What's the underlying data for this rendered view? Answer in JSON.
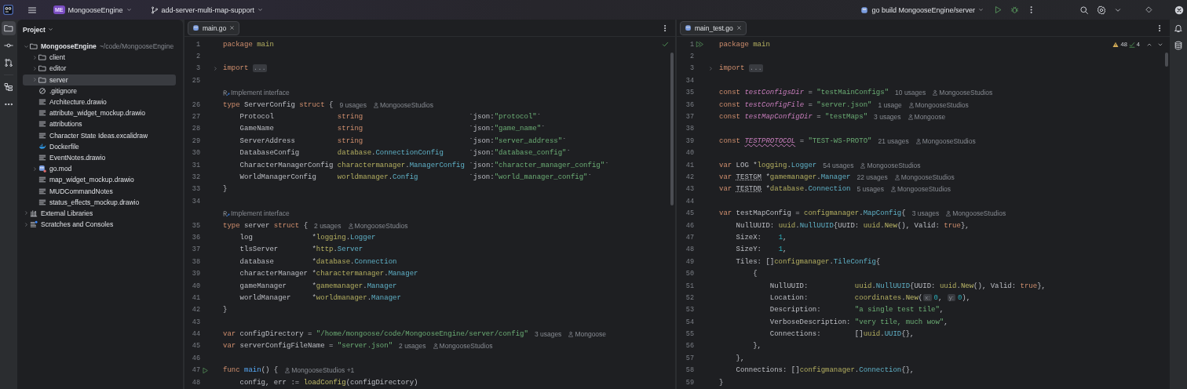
{
  "title_bar": {
    "project_badge": "ME",
    "project": "MongooseEngine",
    "branch": "add-server-multi-map-support",
    "run_configuration": "go build MongooseEngine/server"
  },
  "left_toolbar": [
    {
      "kind": "project",
      "selected": true
    },
    {
      "kind": "commit",
      "selected": false
    },
    {
      "kind": "pull-requests",
      "selected": false
    },
    {
      "kind": "structure",
      "selected": false
    },
    {
      "kind": "more",
      "selected": false
    }
  ],
  "right_toolbar": [
    {
      "kind": "notifications",
      "selected": false
    },
    {
      "kind": "database",
      "selected": false
    }
  ],
  "project": {
    "title": "Project",
    "tree": [
      {
        "label": "MongooseEngine",
        "hint": "~/code/MongooseEngine",
        "kind": "folder",
        "expanded": true,
        "selected": false,
        "children": [
          {
            "label": "client",
            "kind": "folder",
            "expanded": false,
            "selected": false
          },
          {
            "label": "editor",
            "kind": "folder",
            "expanded": false,
            "selected": false
          },
          {
            "label": "server",
            "kind": "folder",
            "expanded": false,
            "selected": true
          },
          {
            "label": ".gitignore",
            "kind": "ignore",
            "selected": false
          },
          {
            "label": "Architecture.drawio",
            "kind": "text",
            "selected": false
          },
          {
            "label": "attribute_widget_mockup.drawio",
            "kind": "text",
            "selected": false
          },
          {
            "label": "attributions",
            "kind": "text",
            "selected": false
          },
          {
            "label": "Character State Ideas.excalidraw",
            "kind": "text",
            "selected": false
          },
          {
            "label": "Dockerfile",
            "kind": "docker",
            "selected": false
          },
          {
            "label": "EventNotes.drawio",
            "kind": "text",
            "selected": false
          },
          {
            "label": "go.mod",
            "kind": "gomod",
            "expanded": false,
            "selected": false
          },
          {
            "label": "map_widget_mockup.drawio",
            "kind": "text",
            "selected": false
          },
          {
            "label": "MUDCommandNotes",
            "kind": "text",
            "selected": false
          },
          {
            "label": "status_effects_mockup.drawio",
            "kind": "text",
            "selected": false
          }
        ]
      },
      {
        "label": "External Libraries",
        "kind": "library",
        "expanded": false,
        "selected": false
      },
      {
        "label": "Scratches and Consoles",
        "kind": "scratches",
        "expanded": false,
        "selected": false
      }
    ]
  },
  "editors": [
    {
      "tabs": [
        {
          "label": "main.go",
          "selected": true
        }
      ],
      "inspection": {
        "kind": "clean"
      },
      "lines": [
        {
          "number": "1",
          "code": [
            {
              "kind": "kw",
              "text": "package"
            },
            {
              "kind": "pkg",
              "text": " main"
            }
          ]
        },
        {
          "number": "2"
        },
        {
          "number": "3",
          "kind": "fold",
          "code": [
            {
              "kind": "kw",
              "text": "import"
            },
            {
              "kind": "fold",
              "text": "..."
            }
          ]
        },
        {
          "number": "25"
        },
        {
          "kind": "lens",
          "text": "Implement interface"
        },
        {
          "number": "26",
          "code": [
            {
              "kind": "kw",
              "text": "type"
            },
            {
              "kind": "plain",
              "text": " ServerConfig "
            },
            {
              "kind": "kw",
              "text": "struct"
            },
            {
              "kind": "plain",
              "text": " {"
            }
          ],
          "hints": [
            {
              "kind": "usages",
              "text": "9 usages"
            },
            {
              "kind": "author",
              "text": "MongooseStudios"
            }
          ]
        },
        {
          "number": "27",
          "code": [
            {
              "kind": "plain",
              "text": "    Protocol               "
            },
            {
              "kind": "kw",
              "text": "string"
            },
            {
              "kind": "plain",
              "text": "                         `json:"
            },
            {
              "kind": "str",
              "text": "\"protocol\""
            },
            {
              "kind": "plain",
              "text": "`"
            }
          ]
        },
        {
          "number": "28",
          "code": [
            {
              "kind": "plain",
              "text": "    GameName               "
            },
            {
              "kind": "kw",
              "text": "string"
            },
            {
              "kind": "plain",
              "text": "                         `json:"
            },
            {
              "kind": "str",
              "text": "\"game_name\""
            },
            {
              "kind": "plain",
              "text": "`"
            }
          ]
        },
        {
          "number": "29",
          "code": [
            {
              "kind": "plain",
              "text": "    ServerAddress          "
            },
            {
              "kind": "kw",
              "text": "string"
            },
            {
              "kind": "plain",
              "text": "                         `json:"
            },
            {
              "kind": "str",
              "text": "\"server_address\""
            },
            {
              "kind": "plain",
              "text": "`"
            }
          ]
        },
        {
          "number": "30",
          "code": [
            {
              "kind": "plain",
              "text": "    DatabaseConfig         "
            },
            {
              "kind": "pkg",
              "text": "database"
            },
            {
              "kind": "plain",
              "text": "."
            },
            {
              "kind": "type",
              "text": "ConnectionConfig"
            },
            {
              "kind": "plain",
              "text": "      `json:"
            },
            {
              "kind": "str",
              "text": "\"database_config\""
            },
            {
              "kind": "plain",
              "text": "`"
            }
          ]
        },
        {
          "number": "31",
          "code": [
            {
              "kind": "plain",
              "text": "    CharacterManagerConfig "
            },
            {
              "kind": "pkg",
              "text": "charactermanager"
            },
            {
              "kind": "plain",
              "text": "."
            },
            {
              "kind": "type",
              "text": "ManagerConfig"
            },
            {
              "kind": "plain",
              "text": " `json:"
            },
            {
              "kind": "str",
              "text": "\"character_manager_config\""
            },
            {
              "kind": "plain",
              "text": "`"
            }
          ]
        },
        {
          "number": "32",
          "code": [
            {
              "kind": "plain",
              "text": "    WorldManagerConfig     "
            },
            {
              "kind": "pkg",
              "text": "worldmanager"
            },
            {
              "kind": "plain",
              "text": "."
            },
            {
              "kind": "type",
              "text": "Config"
            },
            {
              "kind": "plain",
              "text": "            `json:"
            },
            {
              "kind": "str",
              "text": "\"world_manager_config\""
            },
            {
              "kind": "plain",
              "text": "`"
            }
          ]
        },
        {
          "number": "33",
          "code": [
            {
              "kind": "plain",
              "text": "}"
            }
          ]
        },
        {
          "number": "34"
        },
        {
          "kind": "lens",
          "text": "Implement interface"
        },
        {
          "number": "35",
          "code": [
            {
              "kind": "kw",
              "text": "type"
            },
            {
              "kind": "plain",
              "text": " server "
            },
            {
              "kind": "kw",
              "text": "struct"
            },
            {
              "kind": "plain",
              "text": " {"
            }
          ],
          "hints": [
            {
              "kind": "usages",
              "text": "2 usages"
            },
            {
              "kind": "author",
              "text": "MongooseStudios"
            }
          ]
        },
        {
          "number": "36",
          "code": [
            {
              "kind": "plain",
              "text": "    log              *"
            },
            {
              "kind": "pkg",
              "text": "logging"
            },
            {
              "kind": "plain",
              "text": "."
            },
            {
              "kind": "type",
              "text": "Logger"
            }
          ]
        },
        {
          "number": "37",
          "code": [
            {
              "kind": "plain",
              "text": "    tlsServer        *"
            },
            {
              "kind": "pkg",
              "text": "http"
            },
            {
              "kind": "plain",
              "text": "."
            },
            {
              "kind": "type",
              "text": "Server"
            }
          ]
        },
        {
          "number": "38",
          "code": [
            {
              "kind": "plain",
              "text": "    database         *"
            },
            {
              "kind": "pkg",
              "text": "database"
            },
            {
              "kind": "plain",
              "text": "."
            },
            {
              "kind": "type",
              "text": "Connection"
            }
          ]
        },
        {
          "number": "39",
          "code": [
            {
              "kind": "plain",
              "text": "    characterManager *"
            },
            {
              "kind": "pkg",
              "text": "charactermanager"
            },
            {
              "kind": "plain",
              "text": "."
            },
            {
              "kind": "type",
              "text": "Manager"
            }
          ]
        },
        {
          "number": "40",
          "code": [
            {
              "kind": "plain",
              "text": "    gameManager      *"
            },
            {
              "kind": "pkg",
              "text": "gamemanager"
            },
            {
              "kind": "plain",
              "text": "."
            },
            {
              "kind": "type",
              "text": "Manager"
            }
          ]
        },
        {
          "number": "41",
          "code": [
            {
              "kind": "plain",
              "text": "    worldManager     *"
            },
            {
              "kind": "pkg",
              "text": "worldmanager"
            },
            {
              "kind": "plain",
              "text": "."
            },
            {
              "kind": "type",
              "text": "Manager"
            }
          ]
        },
        {
          "number": "42",
          "code": [
            {
              "kind": "plain",
              "text": "}"
            }
          ]
        },
        {
          "number": "43"
        },
        {
          "number": "44",
          "code": [
            {
              "kind": "kw",
              "text": "var"
            },
            {
              "kind": "plain",
              "text": " configDirectory = "
            },
            {
              "kind": "str",
              "text": "\"/home/mongoose/code/MongooseEngine/server/config\""
            }
          ],
          "hints": [
            {
              "kind": "usages",
              "text": "3 usages"
            },
            {
              "kind": "author",
              "text": "Mongoose"
            }
          ]
        },
        {
          "number": "45",
          "code": [
            {
              "kind": "kw",
              "text": "var"
            },
            {
              "kind": "plain",
              "text": " serverConfigFileName = "
            },
            {
              "kind": "str",
              "text": "\"server.json\""
            }
          ],
          "hints": [
            {
              "kind": "usages",
              "text": "2 usages"
            },
            {
              "kind": "author",
              "text": "MongooseStudios"
            }
          ]
        },
        {
          "number": "46"
        },
        {
          "number": "47",
          "kind": "run",
          "code": [
            {
              "kind": "kw",
              "text": "func"
            },
            {
              "kind": "decl",
              "text": " main"
            },
            {
              "kind": "plain",
              "text": "() {"
            }
          ],
          "hints": [
            {
              "kind": "author",
              "text": "MongooseStudios +1"
            }
          ]
        },
        {
          "number": "48",
          "code": [
            {
              "kind": "plain",
              "text": "    config, err := "
            },
            {
              "kind": "fn",
              "text": "loadConfig"
            },
            {
              "kind": "plain",
              "text": "(configDirectory)"
            }
          ]
        }
      ]
    },
    {
      "tabs": [
        {
          "label": "main_test.go",
          "selected": true
        }
      ],
      "inspection": {
        "kind": "counts",
        "warnings": "48",
        "weak_warnings": "4"
      },
      "lines": [
        {
          "number": "1",
          "kind": "run-all",
          "code": [
            {
              "kind": "kw",
              "text": "package"
            },
            {
              "kind": "pkg",
              "text": " main"
            }
          ]
        },
        {
          "number": "2"
        },
        {
          "number": "3",
          "kind": "fold",
          "code": [
            {
              "kind": "kw",
              "text": "import"
            },
            {
              "kind": "fold",
              "text": "..."
            }
          ]
        },
        {
          "number": "34"
        },
        {
          "number": "35",
          "code": [
            {
              "kind": "kw",
              "text": "const"
            },
            {
              "kind": "const",
              "text": " testConfigsDir"
            },
            {
              "kind": "plain",
              "text": " = "
            },
            {
              "kind": "str",
              "text": "\"testMainConfigs\""
            }
          ],
          "hints": [
            {
              "kind": "usages",
              "text": "10 usages"
            },
            {
              "kind": "author",
              "text": "MongooseStudios"
            }
          ]
        },
        {
          "number": "36",
          "code": [
            {
              "kind": "kw",
              "text": "const"
            },
            {
              "kind": "const",
              "text": " testConfigFile"
            },
            {
              "kind": "plain",
              "text": " = "
            },
            {
              "kind": "str",
              "text": "\"server.json\""
            }
          ],
          "hints": [
            {
              "kind": "usages",
              "text": "1 usage"
            },
            {
              "kind": "author",
              "text": "MongooseStudios"
            }
          ]
        },
        {
          "number": "37",
          "code": [
            {
              "kind": "kw",
              "text": "const"
            },
            {
              "kind": "const",
              "text": " testMapConfigDir"
            },
            {
              "kind": "plain",
              "text": " = "
            },
            {
              "kind": "str",
              "text": "\"testMaps\""
            }
          ],
          "hints": [
            {
              "kind": "usages",
              "text": "3 usages"
            },
            {
              "kind": "author",
              "text": "Mongoose"
            }
          ]
        },
        {
          "number": "38"
        },
        {
          "number": "39",
          "code": [
            {
              "kind": "kw",
              "text": "const"
            },
            {
              "kind": "const-warn",
              "text": "TESTPROTOCOL"
            },
            {
              "kind": "plain",
              "text": " = "
            },
            {
              "kind": "str",
              "text": "\"TEST-WS-PROTO\""
            }
          ],
          "hints": [
            {
              "kind": "usages",
              "text": "21 usages"
            },
            {
              "kind": "author",
              "text": "MongooseStudios"
            }
          ]
        },
        {
          "number": "40"
        },
        {
          "number": "41",
          "code": [
            {
              "kind": "kw",
              "text": "var"
            },
            {
              "kind": "plain",
              "text": " LOG *"
            },
            {
              "kind": "pkg",
              "text": "logging"
            },
            {
              "kind": "plain",
              "text": "."
            },
            {
              "kind": "type",
              "text": "Logger"
            }
          ],
          "hints": [
            {
              "kind": "usages",
              "text": "54 usages"
            },
            {
              "kind": "author",
              "text": "MongooseStudios"
            }
          ]
        },
        {
          "number": "42",
          "code": [
            {
              "kind": "kw",
              "text": "var"
            },
            {
              "kind": "plain-warn",
              "text": "TESTGM"
            },
            {
              "kind": "plain",
              "text": " *"
            },
            {
              "kind": "pkg",
              "text": "gamemanager"
            },
            {
              "kind": "plain",
              "text": "."
            },
            {
              "kind": "type",
              "text": "Manager"
            }
          ],
          "hints": [
            {
              "kind": "usages",
              "text": "22 usages"
            },
            {
              "kind": "author",
              "text": "MongooseStudios"
            }
          ]
        },
        {
          "number": "43",
          "code": [
            {
              "kind": "kw",
              "text": "var"
            },
            {
              "kind": "plain-warn",
              "text": "TESTDB"
            },
            {
              "kind": "plain",
              "text": " *"
            },
            {
              "kind": "pkg",
              "text": "database"
            },
            {
              "kind": "plain",
              "text": "."
            },
            {
              "kind": "type",
              "text": "Connection"
            }
          ],
          "hints": [
            {
              "kind": "usages",
              "text": "5 usages"
            },
            {
              "kind": "author",
              "text": "MongooseStudios"
            }
          ]
        },
        {
          "number": "44"
        },
        {
          "number": "45",
          "code": [
            {
              "kind": "kw",
              "text": "var"
            },
            {
              "kind": "plain",
              "text": " testMapConfig = "
            },
            {
              "kind": "pkg",
              "text": "configmanager"
            },
            {
              "kind": "plain",
              "text": "."
            },
            {
              "kind": "type",
              "text": "MapConfig"
            },
            {
              "kind": "plain",
              "text": "{"
            }
          ],
          "hints": [
            {
              "kind": "usages",
              "text": "3 usages"
            },
            {
              "kind": "author",
              "text": "MongooseStudios"
            }
          ]
        },
        {
          "number": "46",
          "code": [
            {
              "kind": "plain",
              "text": "    NullUUID: "
            },
            {
              "kind": "pkg",
              "text": "uuid"
            },
            {
              "kind": "plain",
              "text": "."
            },
            {
              "kind": "type",
              "text": "NullUUID"
            },
            {
              "kind": "plain",
              "text": "{UUID: "
            },
            {
              "kind": "pkg",
              "text": "uuid"
            },
            {
              "kind": "plain",
              "text": "."
            },
            {
              "kind": "fn",
              "text": "New"
            },
            {
              "kind": "plain",
              "text": "(), Valid: "
            },
            {
              "kind": "kw",
              "text": "true"
            },
            {
              "kind": "plain",
              "text": "},"
            }
          ]
        },
        {
          "number": "47",
          "code": [
            {
              "kind": "plain",
              "text": "    SizeX:    "
            },
            {
              "kind": "num",
              "text": "1"
            },
            {
              "kind": "plain",
              "text": ","
            }
          ]
        },
        {
          "number": "48",
          "code": [
            {
              "kind": "plain",
              "text": "    SizeY:    "
            },
            {
              "kind": "num",
              "text": "1"
            },
            {
              "kind": "plain",
              "text": ","
            }
          ]
        },
        {
          "number": "49",
          "code": [
            {
              "kind": "plain",
              "text": "    Tiles: []"
            },
            {
              "kind": "pkg",
              "text": "configmanager"
            },
            {
              "kind": "plain",
              "text": "."
            },
            {
              "kind": "type",
              "text": "TileConfig"
            },
            {
              "kind": "plain",
              "text": "{"
            }
          ]
        },
        {
          "number": "50",
          "code": [
            {
              "kind": "plain",
              "text": "        {"
            }
          ]
        },
        {
          "number": "51",
          "code": [
            {
              "kind": "plain",
              "text": "            NullUUID:           "
            },
            {
              "kind": "pkg",
              "text": "uuid"
            },
            {
              "kind": "plain",
              "text": "."
            },
            {
              "kind": "type",
              "text": "NullUUID"
            },
            {
              "kind": "plain",
              "text": "{UUID: "
            },
            {
              "kind": "pkg",
              "text": "uuid"
            },
            {
              "kind": "plain",
              "text": "."
            },
            {
              "kind": "fn",
              "text": "New"
            },
            {
              "kind": "plain",
              "text": "(), Valid: "
            },
            {
              "kind": "kw",
              "text": "true"
            },
            {
              "kind": "plain",
              "text": "},"
            }
          ]
        },
        {
          "number": "52",
          "code": [
            {
              "kind": "plain",
              "text": "            Location:           "
            },
            {
              "kind": "pkg",
              "text": "coordinates"
            },
            {
              "kind": "plain",
              "text": "."
            },
            {
              "kind": "fn",
              "text": "New"
            },
            {
              "kind": "plain",
              "text": "("
            },
            {
              "kind": "param",
              "text": "x:"
            },
            {
              "kind": "num",
              "text": "0"
            },
            {
              "kind": "plain",
              "text": ", "
            },
            {
              "kind": "param",
              "text": "y:"
            },
            {
              "kind": "num",
              "text": "0"
            },
            {
              "kind": "plain",
              "text": "),"
            }
          ]
        },
        {
          "number": "53",
          "code": [
            {
              "kind": "plain",
              "text": "            Description:        "
            },
            {
              "kind": "str",
              "text": "\"a single test tile\""
            },
            {
              "kind": "plain",
              "text": ","
            }
          ]
        },
        {
          "number": "54",
          "code": [
            {
              "kind": "plain",
              "text": "            VerboseDescription: "
            },
            {
              "kind": "str",
              "text": "\"very tile, much wow\""
            },
            {
              "kind": "plain",
              "text": ","
            }
          ]
        },
        {
          "number": "55",
          "code": [
            {
              "kind": "plain",
              "text": "            Connections:        []"
            },
            {
              "kind": "pkg",
              "text": "uuid"
            },
            {
              "kind": "plain",
              "text": "."
            },
            {
              "kind": "type",
              "text": "UUID"
            },
            {
              "kind": "plain",
              "text": "{},"
            }
          ]
        },
        {
          "number": "56",
          "code": [
            {
              "kind": "plain",
              "text": "        },"
            }
          ]
        },
        {
          "number": "57",
          "code": [
            {
              "kind": "plain",
              "text": "    },"
            }
          ]
        },
        {
          "number": "58",
          "code": [
            {
              "kind": "plain",
              "text": "    Connections: []"
            },
            {
              "kind": "pkg",
              "text": "configmanager"
            },
            {
              "kind": "plain",
              "text": "."
            },
            {
              "kind": "type",
              "text": "Connection"
            },
            {
              "kind": "plain",
              "text": "{},"
            }
          ]
        },
        {
          "number": "59",
          "code": [
            {
              "kind": "plain",
              "text": "}"
            }
          ]
        }
      ]
    }
  ]
}
